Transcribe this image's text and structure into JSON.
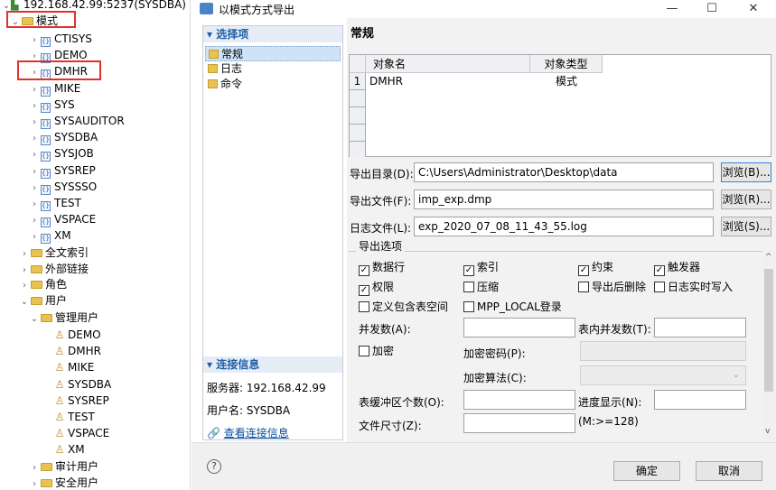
{
  "tree": {
    "server": "192.168.42.99:5237(SYSDBA)",
    "schema_folder": "模式",
    "schemas": [
      "CTISYS",
      "DEMO",
      "DMHR",
      "MIKE",
      "SYS",
      "SYSAUDITOR",
      "SYSDBA",
      "SYSJOB",
      "SYSREP",
      "SYSSSO",
      "TEST",
      "VSPACE",
      "XM"
    ],
    "folders": [
      "全文索引",
      "外部链接",
      "角色"
    ],
    "users_folder": "用户",
    "admin_users_folder": "管理用户",
    "admin_users": [
      "DEMO",
      "DMHR",
      "MIKE",
      "SYSDBA",
      "SYSREP",
      "TEST",
      "VSPACE",
      "XM"
    ],
    "audit_users_folder": "审计用户",
    "security_users_folder": "安全用户"
  },
  "dialog": {
    "title": "以模式方式导出",
    "min": "—",
    "max": "☐",
    "close": "✕",
    "select_header": "▾ 选择项",
    "nav": [
      "常规",
      "日志",
      "命令"
    ],
    "conn_header": "▾ 连接信息",
    "server_info": "服务器: 192.168.42.99",
    "user_info": "用户名: SYSDBA",
    "view_conn": "查看连接信息",
    "section": "常规",
    "grid": {
      "headers": [
        "对象名",
        "对象类型"
      ],
      "rows": [
        {
          "num": "1",
          "name": "DMHR",
          "type": "模式"
        }
      ]
    },
    "dir_label": "导出目录(D):",
    "dir_value": "C:\\Users\\Administrator\\Desktop\\data",
    "dir_browse": "浏览(B)...",
    "file_label": "导出文件(F):",
    "file_value": "imp_exp.dmp",
    "file_browse": "浏览(R)...",
    "log_label": "日志文件(L):",
    "log_value": "exp_2020_07_08_11_43_55.log",
    "log_browse": "浏览(S)...",
    "options_title": "导出选项",
    "options": [
      {
        "label": "数据行",
        "checked": true
      },
      {
        "label": "索引",
        "checked": true
      },
      {
        "label": "约束",
        "checked": true
      },
      {
        "label": "触发器",
        "checked": true
      },
      {
        "label": "权限",
        "checked": true
      },
      {
        "label": "压缩",
        "checked": false
      },
      {
        "label": "导出后删除",
        "checked": false
      },
      {
        "label": "日志实时写入",
        "checked": false
      },
      {
        "label": "定义包含表空间",
        "checked": false
      },
      {
        "label": "MPP_LOCAL登录",
        "checked": false
      }
    ],
    "parallel_label": "并发数(A):",
    "table_parallel_label": "表内并发数(T):",
    "encrypt_label": "加密",
    "encrypt_checked": false,
    "encrypt_pwd_label": "加密密码(P):",
    "encrypt_algo_label": "加密算法(C):",
    "buffer_label": "表缓冲区个数(O):",
    "progress_label": "进度显示(N):",
    "filesize_label": "文件尺寸(Z):",
    "filesize_hint": "(M:>=128)",
    "help": "?",
    "ok": "确定",
    "cancel": "取消"
  }
}
